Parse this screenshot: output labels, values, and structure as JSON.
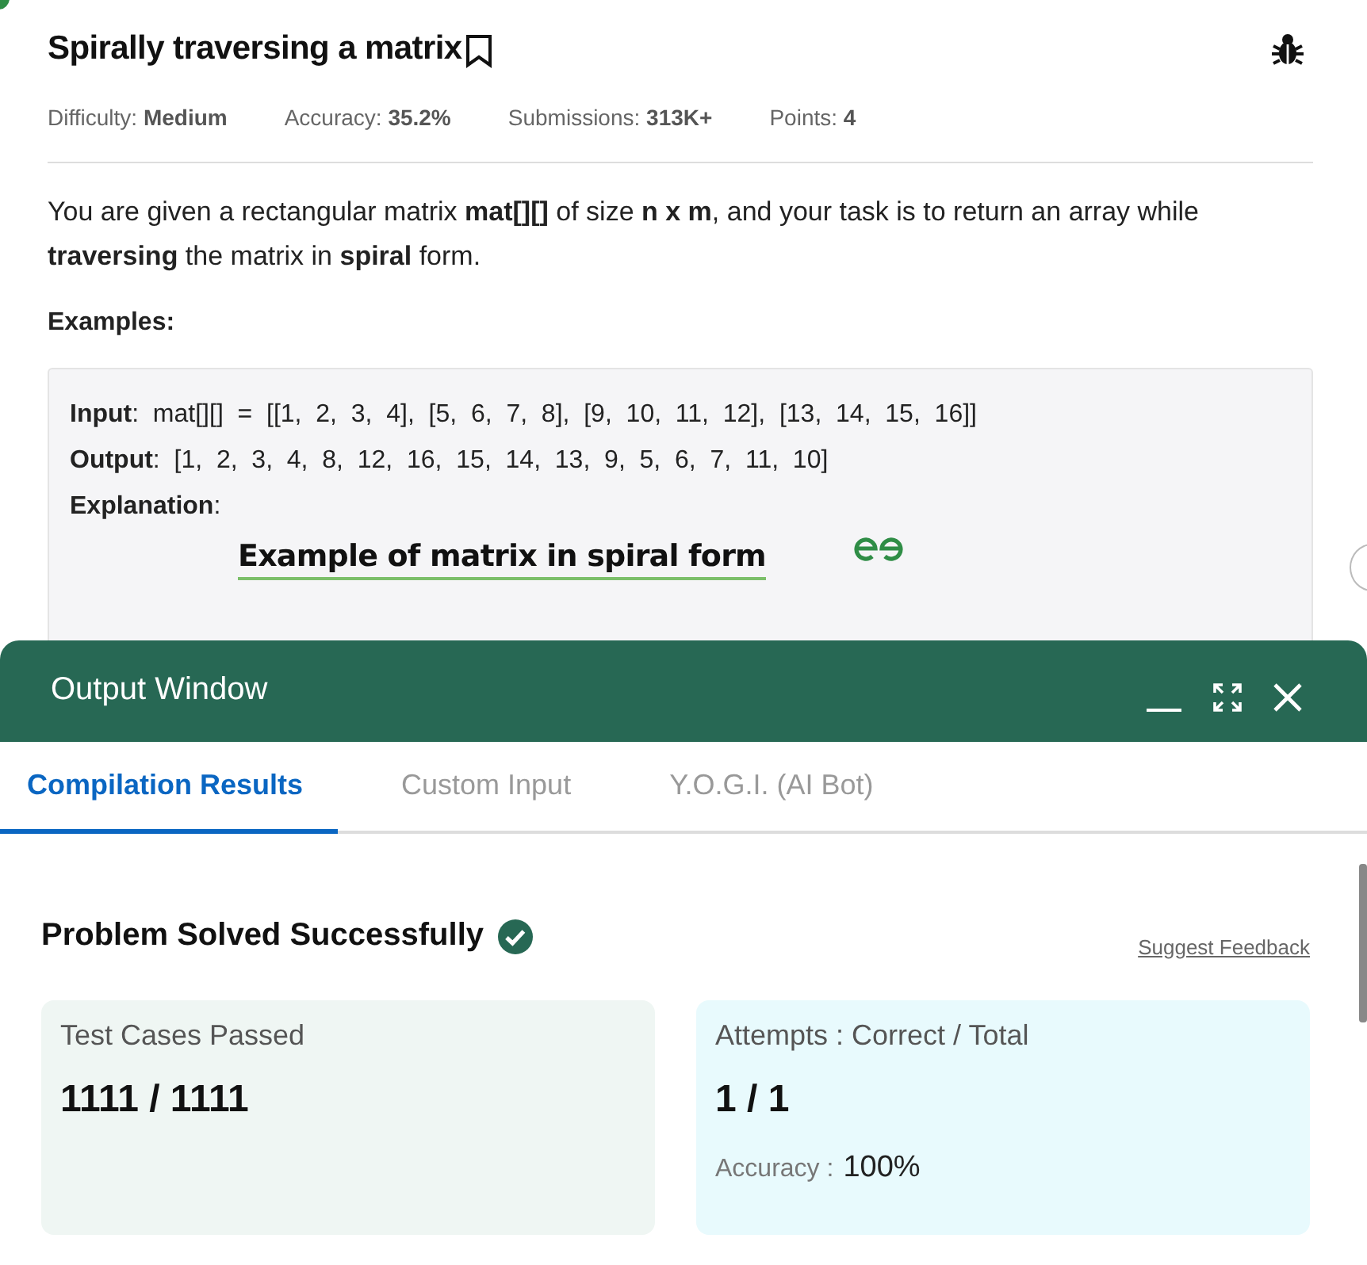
{
  "problem": {
    "title": "Spirally traversing a matrix",
    "meta": [
      {
        "label": "Difficulty:",
        "value": "Medium"
      },
      {
        "label": "Accuracy:",
        "value": "35.2%"
      },
      {
        "label": "Submissions:",
        "value": "313K+"
      },
      {
        "label": "Points:",
        "value": "4"
      }
    ],
    "description": "You are given a rectangular matrix **mat[][]** of size **n x m**, and your task is to return an array while **traversing** the matrix in **spiral** form.",
    "examples_heading": "Examples:",
    "example": {
      "lines": [
        "**Input**:  mat[][]  =  [[1,  2,  3,  4],  [5,  6,  7,  8],  [9,  10,  11,  12],  [13,  14,  15,  16]]",
        "**Output**:  [1,  2,  3,  4,  8,  12,  16,  15,  14,  13,  9,  5,  6,  7,  11,  10]",
        "**Explanation**:"
      ],
      "figure_title": "Example of matrix in spiral form"
    }
  },
  "output_window": {
    "title": "Output Window",
    "tabs": [
      {
        "label": "Compilation Results",
        "selected": true
      },
      {
        "label": "Custom Input",
        "selected": false
      },
      {
        "label": "Y.O.G.I. (AI Bot)",
        "selected": false
      }
    ],
    "status": "Problem Solved Successfully",
    "feedback_link": "Suggest Feedback",
    "cards": [
      {
        "kind": "tests",
        "label": "Test Cases Passed",
        "value": "1111 / 1111"
      },
      {
        "kind": "attempts",
        "label": "Attempts : Correct / Total",
        "value": "1 / 1",
        "sub_label": "Accuracy :",
        "sub_value": "100%"
      }
    ]
  }
}
